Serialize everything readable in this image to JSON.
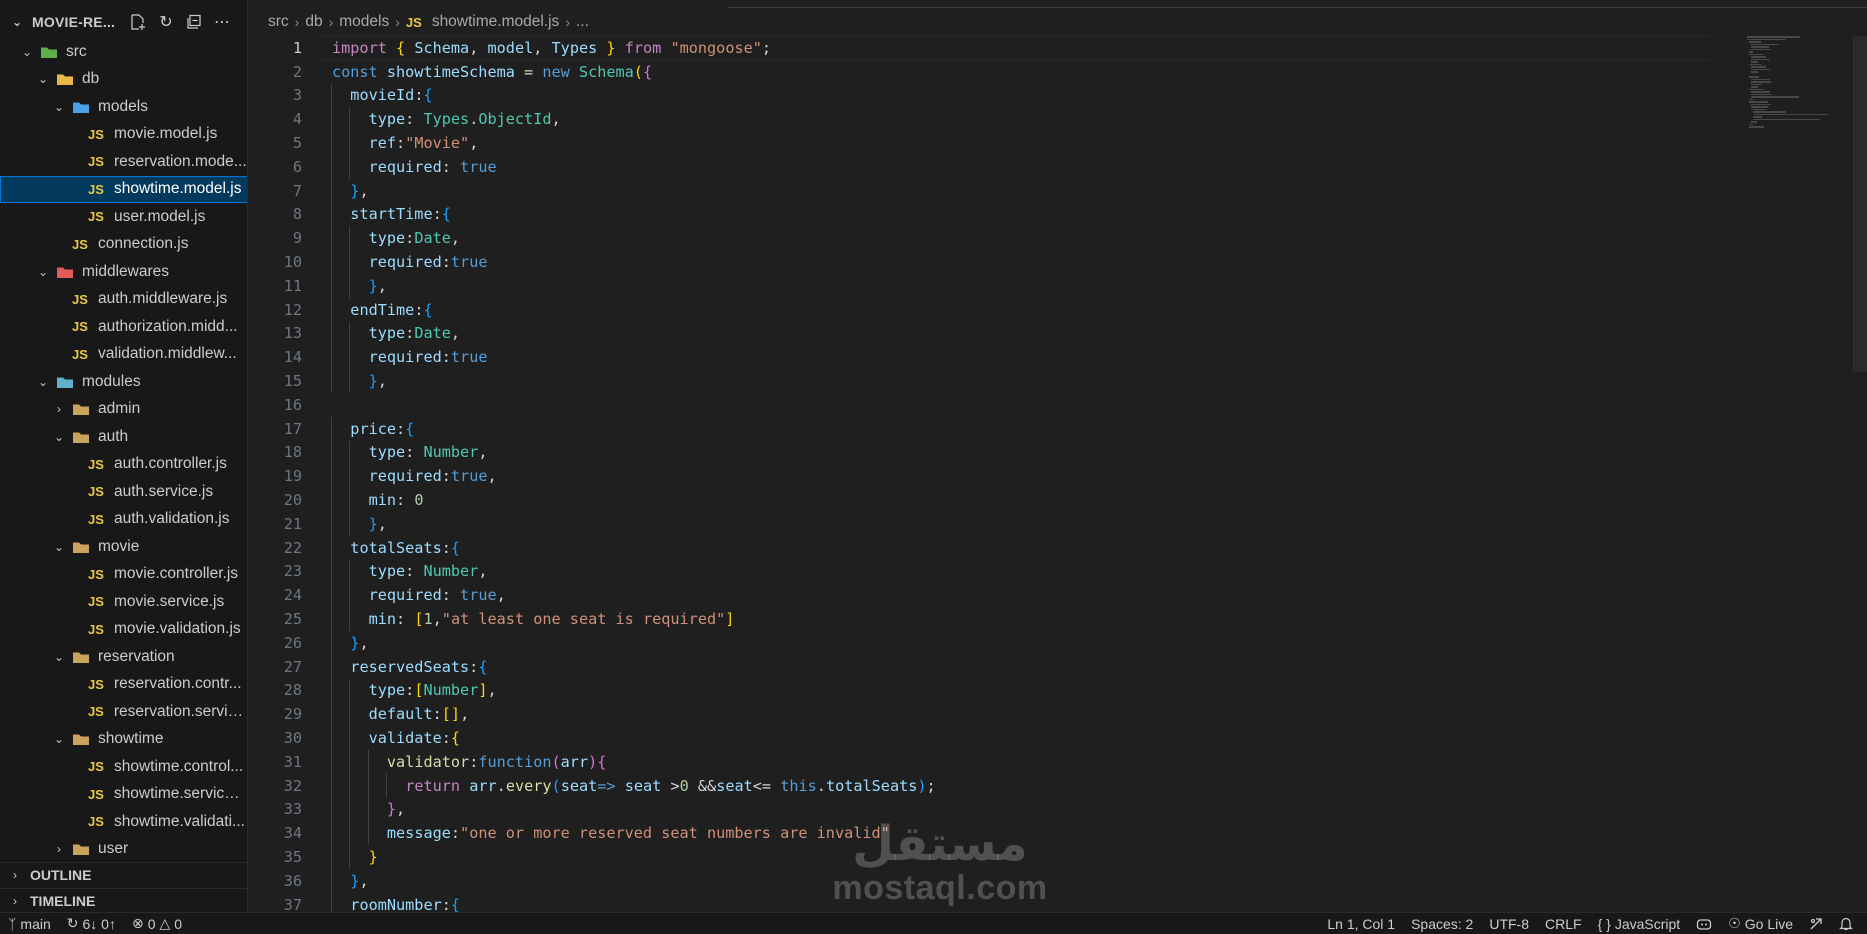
{
  "explorer": {
    "title": "MOVIE-RE...",
    "tools": [
      "new-file-icon",
      "refresh-icon",
      "collapse-all-icon",
      "more-icon"
    ],
    "tree": [
      {
        "label": "src",
        "type": "folder",
        "depth": 0,
        "open": true,
        "icon": "folder-src-icon"
      },
      {
        "label": "db",
        "type": "folder",
        "depth": 1,
        "open": true,
        "icon": "folder-db-icon"
      },
      {
        "label": "models",
        "type": "folder",
        "depth": 2,
        "open": true,
        "icon": "folder-models-icon"
      },
      {
        "label": "movie.model.js",
        "type": "file",
        "depth": 3
      },
      {
        "label": "reservation.mode...",
        "type": "file",
        "depth": 3
      },
      {
        "label": "showtime.model.js",
        "type": "file",
        "depth": 3,
        "selected": true
      },
      {
        "label": "user.model.js",
        "type": "file",
        "depth": 3
      },
      {
        "label": "connection.js",
        "type": "file",
        "depth": 2
      },
      {
        "label": "middlewares",
        "type": "folder",
        "depth": 1,
        "open": true,
        "icon": "folder-middleware-icon"
      },
      {
        "label": "auth.middleware.js",
        "type": "file",
        "depth": 2
      },
      {
        "label": "authorization.midd...",
        "type": "file",
        "depth": 2
      },
      {
        "label": "validation.middlew...",
        "type": "file",
        "depth": 2
      },
      {
        "label": "modules",
        "type": "folder",
        "depth": 1,
        "open": true,
        "icon": "folder-modules-icon"
      },
      {
        "label": "admin",
        "type": "folder",
        "depth": 2,
        "open": false,
        "icon": "folder-icon"
      },
      {
        "label": "auth",
        "type": "folder",
        "depth": 2,
        "open": true,
        "icon": "folder-icon"
      },
      {
        "label": "auth.controller.js",
        "type": "file",
        "depth": 3
      },
      {
        "label": "auth.service.js",
        "type": "file",
        "depth": 3
      },
      {
        "label": "auth.validation.js",
        "type": "file",
        "depth": 3
      },
      {
        "label": "movie",
        "type": "folder",
        "depth": 2,
        "open": true,
        "icon": "folder-icon"
      },
      {
        "label": "movie.controller.js",
        "type": "file",
        "depth": 3
      },
      {
        "label": "movie.service.js",
        "type": "file",
        "depth": 3
      },
      {
        "label": "movie.validation.js",
        "type": "file",
        "depth": 3
      },
      {
        "label": "reservation",
        "type": "folder",
        "depth": 2,
        "open": true,
        "icon": "folder-icon"
      },
      {
        "label": "reservation.contr...",
        "type": "file",
        "depth": 3
      },
      {
        "label": "reservation.servic...",
        "type": "file",
        "depth": 3
      },
      {
        "label": "showtime",
        "type": "folder",
        "depth": 2,
        "open": true,
        "icon": "folder-icon"
      },
      {
        "label": "showtime.control...",
        "type": "file",
        "depth": 3
      },
      {
        "label": "showtime.service.js",
        "type": "file",
        "depth": 3
      },
      {
        "label": "showtime.validati...",
        "type": "file",
        "depth": 3
      },
      {
        "label": "user",
        "type": "folder",
        "depth": 2,
        "open": false,
        "icon": "folder-icon"
      }
    ],
    "file_badge": "JS",
    "outline_label": "OUTLINE",
    "timeline_label": "TIMELINE"
  },
  "breadcrumb": {
    "parts": [
      "src",
      "db",
      "models"
    ],
    "file_badge": "JS",
    "file": "showtime.model.js",
    "tail": "..."
  },
  "editor": {
    "current_line": 1,
    "lines": [
      {
        "n": "1",
        "indent": 0,
        "tokens": [
          [
            "k",
            "import"
          ],
          [
            "o",
            " "
          ],
          [
            "y",
            "{"
          ],
          [
            "o",
            " "
          ],
          [
            "p",
            "Schema"
          ],
          [
            "o",
            ", "
          ],
          [
            "p",
            "model"
          ],
          [
            "o",
            ", "
          ],
          [
            "p",
            "Types"
          ],
          [
            "o",
            " "
          ],
          [
            "y",
            "}"
          ],
          [
            "o",
            " "
          ],
          [
            "k",
            "from"
          ],
          [
            "o",
            " "
          ],
          [
            "s",
            "\"mongoose\""
          ],
          [
            "o",
            ";"
          ]
        ]
      },
      {
        "n": "2",
        "indent": 0,
        "tokens": [
          [
            "b",
            "const"
          ],
          [
            "o",
            " "
          ],
          [
            "p",
            "showtimeSchema"
          ],
          [
            "o",
            " = "
          ],
          [
            "b",
            "new"
          ],
          [
            "o",
            " "
          ],
          [
            "t",
            "Schema"
          ],
          [
            "y",
            "("
          ],
          [
            "m",
            "{"
          ]
        ]
      },
      {
        "n": "3",
        "indent": 1,
        "tokens": [
          [
            "p",
            "movieId"
          ],
          [
            "o",
            ":"
          ],
          [
            "c",
            "{"
          ]
        ]
      },
      {
        "n": "4",
        "indent": 2,
        "tokens": [
          [
            "p",
            "type"
          ],
          [
            "o",
            ": "
          ],
          [
            "t",
            "Types"
          ],
          [
            "o",
            "."
          ],
          [
            "t",
            "ObjectId"
          ],
          [
            "o",
            ","
          ]
        ]
      },
      {
        "n": "5",
        "indent": 2,
        "tokens": [
          [
            "p",
            "ref"
          ],
          [
            "o",
            ":"
          ],
          [
            "s",
            "\"Movie\""
          ],
          [
            "o",
            ","
          ]
        ]
      },
      {
        "n": "6",
        "indent": 2,
        "tokens": [
          [
            "p",
            "required"
          ],
          [
            "o",
            ": "
          ],
          [
            "b",
            "true"
          ]
        ]
      },
      {
        "n": "7",
        "indent": 1,
        "tokens": [
          [
            "c",
            "}"
          ],
          [
            "o",
            ","
          ]
        ]
      },
      {
        "n": "8",
        "indent": 1,
        "tokens": [
          [
            "p",
            "startTime"
          ],
          [
            "o",
            ":"
          ],
          [
            "c",
            "{"
          ]
        ]
      },
      {
        "n": "9",
        "indent": 2,
        "tokens": [
          [
            "p",
            "type"
          ],
          [
            "o",
            ":"
          ],
          [
            "t",
            "Date"
          ],
          [
            "o",
            ","
          ]
        ]
      },
      {
        "n": "10",
        "indent": 2,
        "tokens": [
          [
            "p",
            "required"
          ],
          [
            "o",
            ":"
          ],
          [
            "b",
            "true"
          ]
        ]
      },
      {
        "n": "11",
        "indent": 2,
        "tokens": [
          [
            "c",
            "}"
          ],
          [
            "o",
            ","
          ]
        ]
      },
      {
        "n": "12",
        "indent": 1,
        "tokens": [
          [
            "p",
            "endTime"
          ],
          [
            "o",
            ":"
          ],
          [
            "c",
            "{"
          ]
        ]
      },
      {
        "n": "13",
        "indent": 2,
        "tokens": [
          [
            "p",
            "type"
          ],
          [
            "o",
            ":"
          ],
          [
            "t",
            "Date"
          ],
          [
            "o",
            ","
          ]
        ]
      },
      {
        "n": "14",
        "indent": 2,
        "tokens": [
          [
            "p",
            "required"
          ],
          [
            "o",
            ":"
          ],
          [
            "b",
            "true"
          ]
        ]
      },
      {
        "n": "15",
        "indent": 2,
        "tokens": [
          [
            "c",
            "}"
          ],
          [
            "o",
            ","
          ]
        ]
      },
      {
        "n": "16",
        "indent": 0,
        "tokens": []
      },
      {
        "n": "17",
        "indent": 1,
        "tokens": [
          [
            "p",
            "price"
          ],
          [
            "o",
            ":"
          ],
          [
            "c",
            "{"
          ]
        ]
      },
      {
        "n": "18",
        "indent": 2,
        "tokens": [
          [
            "p",
            "type"
          ],
          [
            "o",
            ": "
          ],
          [
            "t",
            "Number"
          ],
          [
            "o",
            ","
          ]
        ]
      },
      {
        "n": "19",
        "indent": 2,
        "tokens": [
          [
            "p",
            "required"
          ],
          [
            "o",
            ":"
          ],
          [
            "b",
            "true"
          ],
          [
            "o",
            ","
          ]
        ]
      },
      {
        "n": "20",
        "indent": 2,
        "tokens": [
          [
            "p",
            "min"
          ],
          [
            "o",
            ": "
          ],
          [
            "n",
            "0"
          ]
        ]
      },
      {
        "n": "21",
        "indent": 2,
        "tokens": [
          [
            "c",
            "}"
          ],
          [
            "o",
            ","
          ]
        ]
      },
      {
        "n": "22",
        "indent": 1,
        "tokens": [
          [
            "p",
            "totalSeats"
          ],
          [
            "o",
            ":"
          ],
          [
            "c",
            "{"
          ]
        ]
      },
      {
        "n": "23",
        "indent": 2,
        "tokens": [
          [
            "p",
            "type"
          ],
          [
            "o",
            ": "
          ],
          [
            "t",
            "Number"
          ],
          [
            "o",
            ","
          ]
        ]
      },
      {
        "n": "24",
        "indent": 2,
        "tokens": [
          [
            "p",
            "required"
          ],
          [
            "o",
            ": "
          ],
          [
            "b",
            "true"
          ],
          [
            "o",
            ","
          ]
        ]
      },
      {
        "n": "25",
        "indent": 2,
        "tokens": [
          [
            "p",
            "min"
          ],
          [
            "o",
            ": "
          ],
          [
            "y",
            "["
          ],
          [
            "n",
            "1"
          ],
          [
            "o",
            ","
          ],
          [
            "s",
            "\"at least one seat is required\""
          ],
          [
            "y",
            "]"
          ]
        ]
      },
      {
        "n": "26",
        "indent": 1,
        "tokens": [
          [
            "c",
            "}"
          ],
          [
            "o",
            ","
          ]
        ]
      },
      {
        "n": "27",
        "indent": 1,
        "tokens": [
          [
            "p",
            "reservedSeats"
          ],
          [
            "o",
            ":"
          ],
          [
            "c",
            "{"
          ]
        ]
      },
      {
        "n": "28",
        "indent": 2,
        "tokens": [
          [
            "p",
            "type"
          ],
          [
            "o",
            ":"
          ],
          [
            "y",
            "["
          ],
          [
            "t",
            "Number"
          ],
          [
            "y",
            "]"
          ],
          [
            "o",
            ","
          ]
        ]
      },
      {
        "n": "29",
        "indent": 2,
        "tokens": [
          [
            "p",
            "default"
          ],
          [
            "o",
            ":"
          ],
          [
            "y",
            "[]"
          ],
          [
            "o",
            ","
          ]
        ]
      },
      {
        "n": "30",
        "indent": 2,
        "tokens": [
          [
            "p",
            "validate"
          ],
          [
            "o",
            ":"
          ],
          [
            "y",
            "{"
          ]
        ]
      },
      {
        "n": "31",
        "indent": 3,
        "tokens": [
          [
            "f",
            "validator"
          ],
          [
            "o",
            ":"
          ],
          [
            "b",
            "function"
          ],
          [
            "m",
            "("
          ],
          [
            "p",
            "arr"
          ],
          [
            "m",
            ")"
          ],
          [
            "m",
            "{"
          ]
        ]
      },
      {
        "n": "32",
        "indent": 4,
        "tokens": [
          [
            "k",
            "return"
          ],
          [
            "o",
            " "
          ],
          [
            "p",
            "arr"
          ],
          [
            "o",
            "."
          ],
          [
            "f",
            "every"
          ],
          [
            "c",
            "("
          ],
          [
            "p",
            "seat"
          ],
          [
            "b",
            "=>"
          ],
          [
            "o",
            " "
          ],
          [
            "p",
            "seat"
          ],
          [
            "o",
            " >"
          ],
          [
            "n",
            "0"
          ],
          [
            "o",
            " &&"
          ],
          [
            "p",
            "seat"
          ],
          [
            "o",
            "<= "
          ],
          [
            "b",
            "this"
          ],
          [
            "o",
            "."
          ],
          [
            "p",
            "totalSeats"
          ],
          [
            "c",
            ")"
          ],
          [
            "o",
            ";"
          ]
        ]
      },
      {
        "n": "33",
        "indent": 3,
        "tokens": [
          [
            "m",
            "}"
          ],
          [
            "o",
            ","
          ]
        ]
      },
      {
        "n": "34",
        "indent": 3,
        "tokens": [
          [
            "p",
            "message"
          ],
          [
            "o",
            ":"
          ],
          [
            "s",
            "\"one or more reserved seat numbers are invalid\""
          ]
        ]
      },
      {
        "n": "35",
        "indent": 2,
        "tokens": [
          [
            "y",
            "}"
          ]
        ]
      },
      {
        "n": "36",
        "indent": 1,
        "tokens": [
          [
            "c",
            "}"
          ],
          [
            "o",
            ","
          ]
        ]
      },
      {
        "n": "37",
        "indent": 1,
        "tokens": [
          [
            "p",
            "roomNumber"
          ],
          [
            "o",
            ":"
          ],
          [
            "c",
            "{"
          ]
        ]
      }
    ]
  },
  "watermark": {
    "arabic": "مستقل",
    "latin": "mostaql.com"
  },
  "statusbar": {
    "branch": "main",
    "sync": "6↓ 0↑",
    "errors": "0",
    "warnings": "0",
    "position": "Ln 1, Col 1",
    "spaces": "Spaces: 2",
    "encoding": "UTF-8",
    "eol": "CRLF",
    "language": "JavaScript",
    "golive": "Go Live",
    "colors": {
      "background": "#181818",
      "text": "#cccccc"
    }
  },
  "theme": {
    "accent": "#0078d4",
    "selection": "#04395e",
    "js_badge": "#e8c842"
  }
}
